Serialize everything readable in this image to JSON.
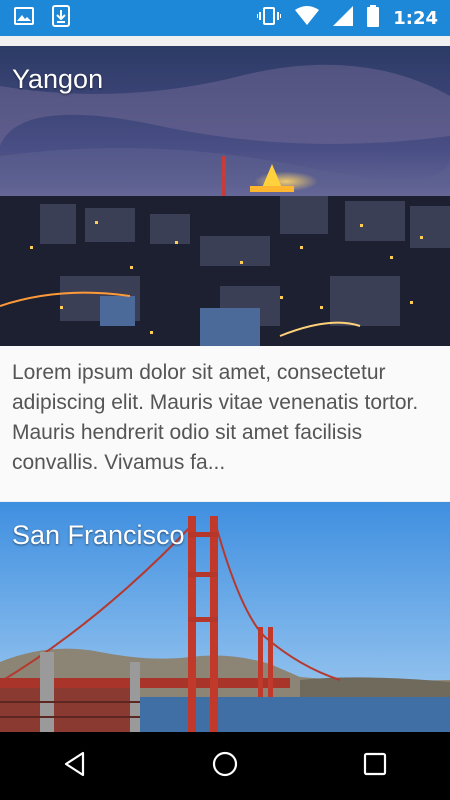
{
  "status_bar": {
    "time": "1:24",
    "left_icons": [
      "image-icon",
      "download-icon"
    ],
    "right_icons": [
      "vibrate-icon",
      "wifi-icon",
      "signal-icon",
      "battery-icon"
    ],
    "color": "#1e88d8"
  },
  "cards": [
    {
      "title": "Yangon",
      "description": "Lorem ipsum dolor sit amet, consectetur adipiscing elit. Mauris vitae venenatis tortor. Mauris hendrerit odio sit amet facilisis convallis. Vivamus fa...",
      "image": "yangon-night-skyline"
    },
    {
      "title": "San Francisco",
      "image": "golden-gate-bridge"
    }
  ],
  "nav_bar": {
    "buttons": [
      "back-icon",
      "home-icon",
      "recents-icon"
    ]
  }
}
